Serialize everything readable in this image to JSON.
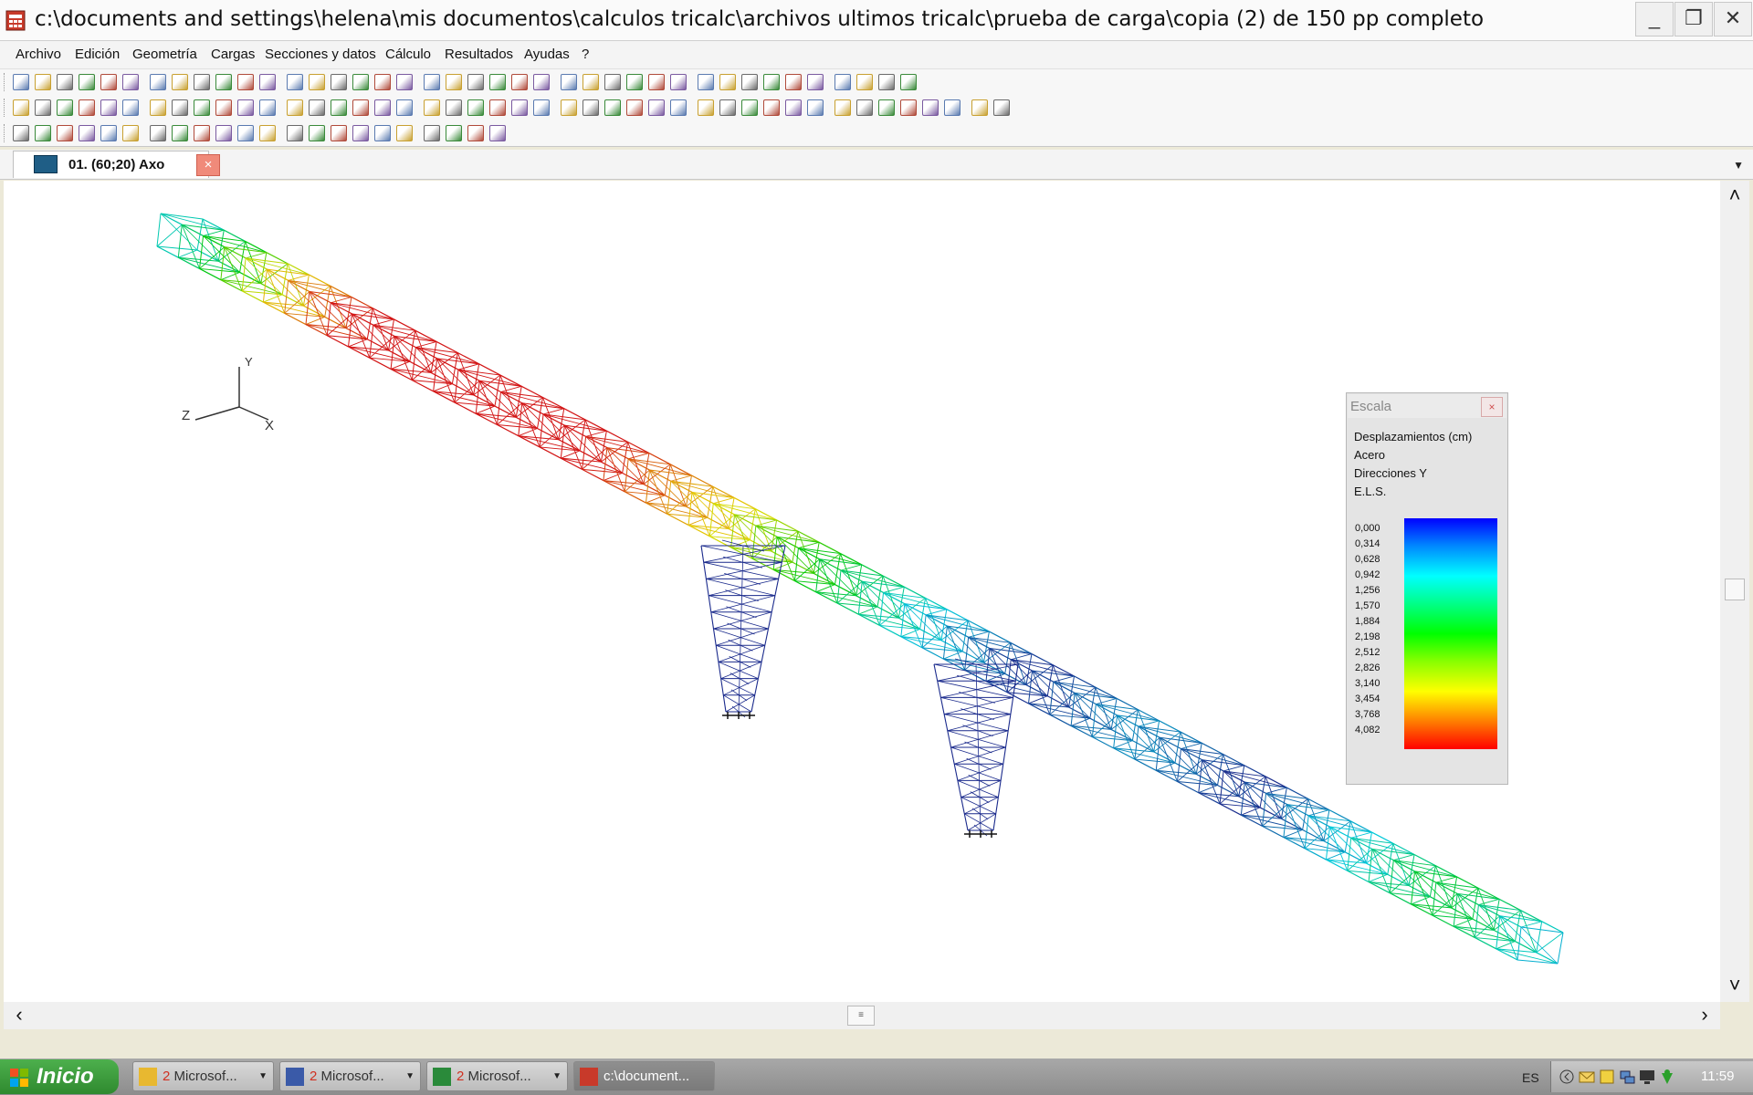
{
  "window": {
    "title": "c:\\documents and settings\\helena\\mis documentos\\calculos tricalc\\archivos ultimos tricalc\\prueba de carga\\copia (2) de 150 pp completo",
    "minimize_glyph": "_",
    "restore_glyph": "❐",
    "close_glyph": "✕"
  },
  "menu": [
    "Archivo",
    "Edición",
    "Geometría",
    "Cargas",
    "Secciones y datos",
    "Cálculo",
    "Resultados",
    "Ayudas",
    "?"
  ],
  "toolbar_rows": [
    {
      "count": 40,
      "icons": [
        "new-file-icon",
        "open-file-icon",
        "open-folder-icon",
        "open-icon",
        "save-icon",
        "save-as-icon",
        "export-icon",
        "import-icon",
        "copy-icon",
        "paste-icon",
        "page-icon",
        "ascii-import-icon",
        "ascii-export-icon",
        "print-icon",
        "print-preview-icon",
        "plot-icon",
        "layout-icon",
        "plan-icon",
        "config-icon",
        "database-icon",
        "dwg-import-icon",
        "dwg-export-icon",
        "dwg-icon",
        "dwg-layer-icon",
        "dwg-block-icon",
        "dxf-icon",
        "block-icon",
        "grid-icon",
        "line-icon",
        "measure-icon",
        "node-label-icon",
        "bar-label-icon",
        "section-icon",
        "palette-icon",
        "color-icon",
        "materials-icon",
        "view-2d-icon",
        "dropdown-icon",
        "settings-icon",
        "help-icon"
      ]
    },
    {
      "count": 44,
      "icons": [
        "undo-icon",
        "redo-icon",
        "cut-icon",
        "copy-icon",
        "paste-icon",
        "duplicate-icon",
        "move-icon",
        "rotate-icon",
        "mirror-icon",
        "select-icon",
        "select-window-icon",
        "select-bar-icon",
        "filter-icon",
        "table-icon",
        "zoom-in-icon",
        "zoom-out-icon",
        "zoom-window-icon",
        "zoom-all-icon",
        "pan-icon",
        "zoom-prev-icon",
        "zoom-next-icon",
        "cube-icon",
        "node-icon",
        "bar-icon",
        "support-icon",
        "frame-icon",
        "view-axo-icon",
        "view-front-icon",
        "view-top-icon",
        "view-side-icon",
        "render-icon",
        "layers-icon",
        "material-icon",
        "mesh-icon",
        "load-icon",
        "combination-icon",
        "report-icon",
        "table-view-icon",
        "list-icon",
        "refresh-icon",
        "dimension-icon",
        "text-icon",
        "scale-icon",
        "dropdown-icon"
      ]
    },
    {
      "count": 22,
      "icons": [
        "prev-icon",
        "next-icon",
        "up-icon",
        "down-icon",
        "mirror-x-icon",
        "mirror-y-icon",
        "first-icon",
        "last-icon",
        "top-icon",
        "bottom-icon",
        "up-down-icon",
        "down-up-icon",
        "left-icon",
        "right-icon",
        "raise-icon",
        "lower-icon",
        "filter-down-icon",
        "diamond-icon",
        "dropdown-icon",
        "play-icon",
        "stop-icon",
        "pause-icon"
      ]
    }
  ],
  "document_tab": {
    "label": "01.  (60;20)  Axo",
    "close_glyph": "×",
    "dropdown_glyph": "▼"
  },
  "axes": {
    "x": "X",
    "y": "Y",
    "z": "Z"
  },
  "legend": {
    "title": "Escala",
    "close_glyph": "×",
    "lines": [
      "Desplazamientos (cm)",
      "Acero",
      "Direcciones Y",
      "E.L.S."
    ],
    "values": [
      "0,000",
      "0,314",
      "0,628",
      "0,942",
      "1,256",
      "1,570",
      "1,884",
      "2,198",
      "2,512",
      "2,826",
      "3,140",
      "3,454",
      "3,768",
      "4,082"
    ]
  },
  "scroll": {
    "up": "˄",
    "down": "˅",
    "left": "‹",
    "right": "›",
    "thumb": "≡"
  },
  "taskbar": {
    "start_label": "Inicio",
    "buttons": [
      {
        "count": "2",
        "label": "Microsof...",
        "icon": "outlook-icon",
        "active": false
      },
      {
        "count": "2",
        "label": "Microsof...",
        "icon": "word-icon",
        "active": false
      },
      {
        "count": "2",
        "label": "Microsof...",
        "icon": "excel-icon",
        "active": false
      },
      {
        "count": "",
        "label": "c:\\document...",
        "icon": "tricalc-icon",
        "active": true
      }
    ],
    "language": "ES",
    "clock": "11:59"
  },
  "colors": {
    "deform_low": "#1a2a8c",
    "deform_mid": "#00c8c8",
    "deform_high": "#d01010",
    "accent": "#2f8a2f"
  }
}
